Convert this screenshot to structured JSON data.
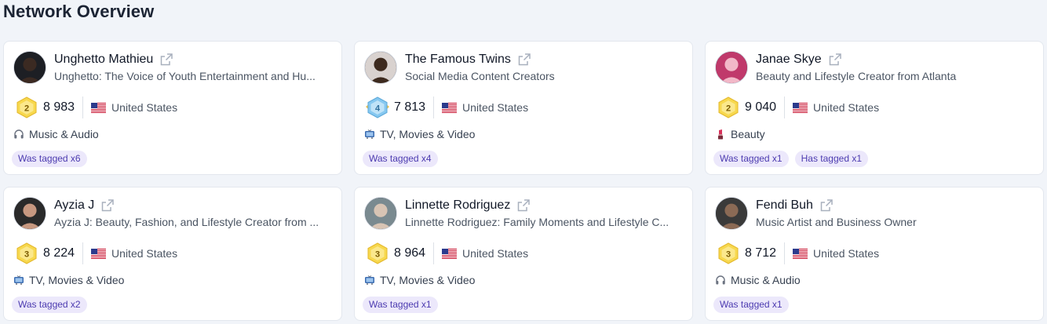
{
  "page": {
    "title": "Network Overview"
  },
  "colors": {
    "accent_tag_bg": "#ece8fb",
    "accent_tag_text": "#4c3bb0",
    "badge_gold": "#f5d64a",
    "badge_blue": "#7cc3ef"
  },
  "cards": [
    {
      "name": "Unghetto Mathieu",
      "description": "Unghetto: The Voice of Youth Entertainment and Hu...",
      "rank": "2",
      "rank_style": "gold",
      "followers": "8 983",
      "country": "United States",
      "category_icon": "headphones-icon",
      "category": "Music & Audio",
      "tags": [
        "Was tagged x6"
      ]
    },
    {
      "name": "The Famous Twins",
      "description": "Social Media Content Creators",
      "rank": "4",
      "rank_style": "blue",
      "followers": "7 813",
      "country": "United States",
      "category_icon": "tv-icon",
      "category": "TV, Movies & Video",
      "tags": [
        "Was tagged x4"
      ]
    },
    {
      "name": "Janae Skye",
      "description": "Beauty and Lifestyle Creator from Atlanta",
      "rank": "2",
      "rank_style": "gold",
      "followers": "9 040",
      "country": "United States",
      "category_icon": "lipstick-icon",
      "category": "Beauty",
      "tags": [
        "Was tagged x1",
        "Has tagged x1"
      ]
    },
    {
      "name": "Ayzia J",
      "description": "Ayzia J: Beauty, Fashion, and Lifestyle Creator from ...",
      "rank": "3",
      "rank_style": "gold",
      "followers": "8 224",
      "country": "United States",
      "category_icon": "tv-icon",
      "category": "TV, Movies & Video",
      "tags": [
        "Was tagged x2"
      ]
    },
    {
      "name": "Linnette Rodriguez",
      "description": "Linnette Rodriguez: Family Moments and Lifestyle C...",
      "rank": "3",
      "rank_style": "gold",
      "followers": "8 964",
      "country": "United States",
      "category_icon": "tv-icon",
      "category": "TV, Movies & Video",
      "tags": [
        "Was tagged x1"
      ]
    },
    {
      "name": "Fendi Buh",
      "description": "Music Artist and Business Owner",
      "rank": "3",
      "rank_style": "gold",
      "followers": "8 712",
      "country": "United States",
      "category_icon": "headphones-icon",
      "category": "Music & Audio",
      "tags": [
        "Was tagged x1"
      ]
    }
  ]
}
